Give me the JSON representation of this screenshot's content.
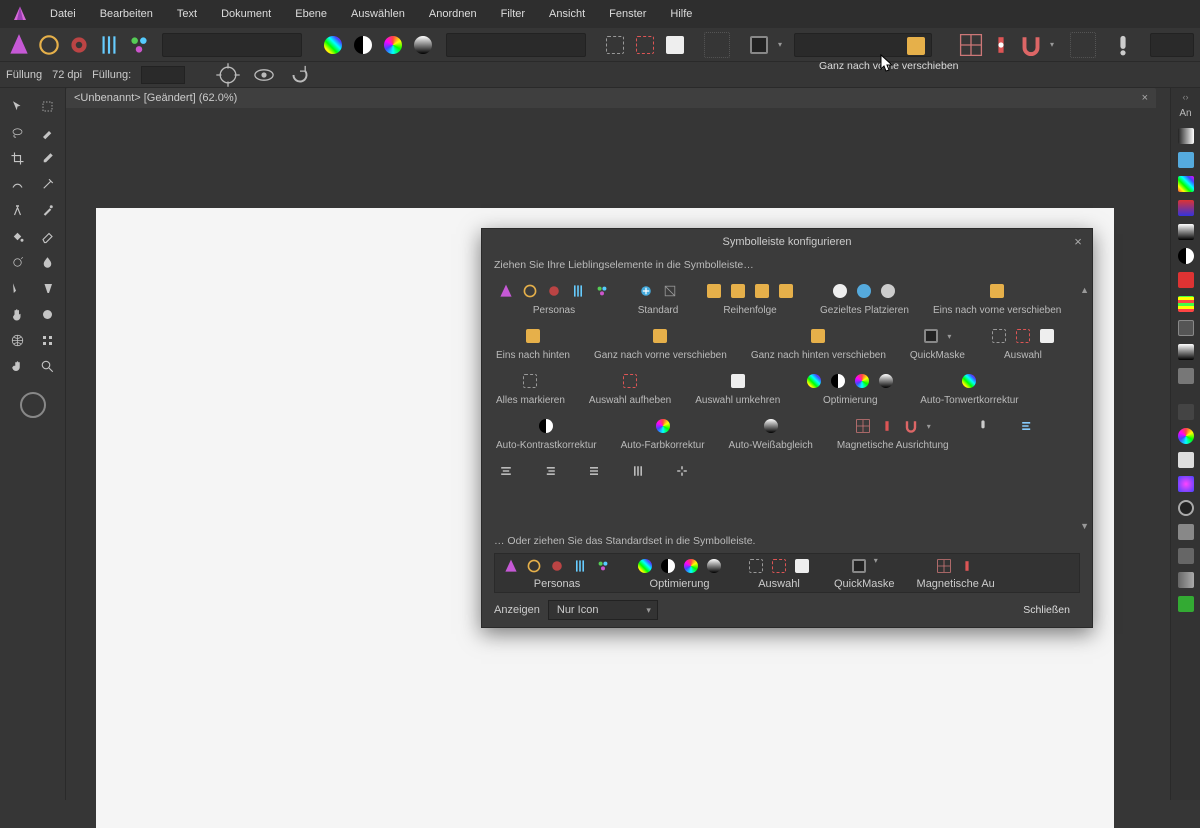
{
  "menubar": {
    "items": [
      "Datei",
      "Bearbeiten",
      "Text",
      "Dokument",
      "Ebene",
      "Auswählen",
      "Anordnen",
      "Filter",
      "Ansicht",
      "Fenster",
      "Hilfe"
    ]
  },
  "contextbar": {
    "fill": "Füllung",
    "dpi": "72 dpi",
    "fill2": "Füllung:"
  },
  "tabstrip": {
    "doc": "<Unbenannt> [Geändert] (62.0%)"
  },
  "tooltip": {
    "text": "Ganz nach vorne verschieben"
  },
  "dialog": {
    "title": "Symbolleiste konfigurieren",
    "hint": "Ziehen Sie Ihre Lieblingselemente in die Symbolleiste…",
    "hint2": "… Oder ziehen Sie das Standardset in die Symbolleiste.",
    "items": [
      {
        "l": "Personas"
      },
      {
        "l": "Standard"
      },
      {
        "l": "Reihenfolge"
      },
      {
        "l": "Gezieltes Platzieren"
      },
      {
        "l": "Eins nach vorne verschieben"
      },
      {
        "l": "Eins nach hinten"
      },
      {
        "l": "Ganz nach vorne verschieben"
      },
      {
        "l": "Ganz nach hinten verschieben"
      },
      {
        "l": "QuickMaske"
      },
      {
        "l": "Auswahl"
      },
      {
        "l": "Alles markieren"
      },
      {
        "l": "Auswahl aufheben"
      },
      {
        "l": "Auswahl umkehren"
      },
      {
        "l": "Optimierung"
      },
      {
        "l": "Auto-Tonwertkorrektur"
      },
      {
        "l": "Auto-Kontrastkorrektur"
      },
      {
        "l": "Auto-Farbkorrektur"
      },
      {
        "l": "Auto-Weißabgleich"
      },
      {
        "l": "Magnetische Ausrichtung"
      },
      {
        "l": ""
      },
      {
        "l": ""
      },
      {
        "l": ""
      },
      {
        "l": ""
      },
      {
        "l": ""
      },
      {
        "l": ""
      },
      {
        "l": ""
      }
    ],
    "default_items": [
      {
        "l": "Personas"
      },
      {
        "l": "Optimierung"
      },
      {
        "l": "Auswahl"
      },
      {
        "l": "QuickMaske"
      },
      {
        "l": "Magnetische Au"
      }
    ],
    "show_label": "Anzeigen",
    "show_value": "Nur Icon",
    "close": "Schließen"
  },
  "studio_label": "An"
}
